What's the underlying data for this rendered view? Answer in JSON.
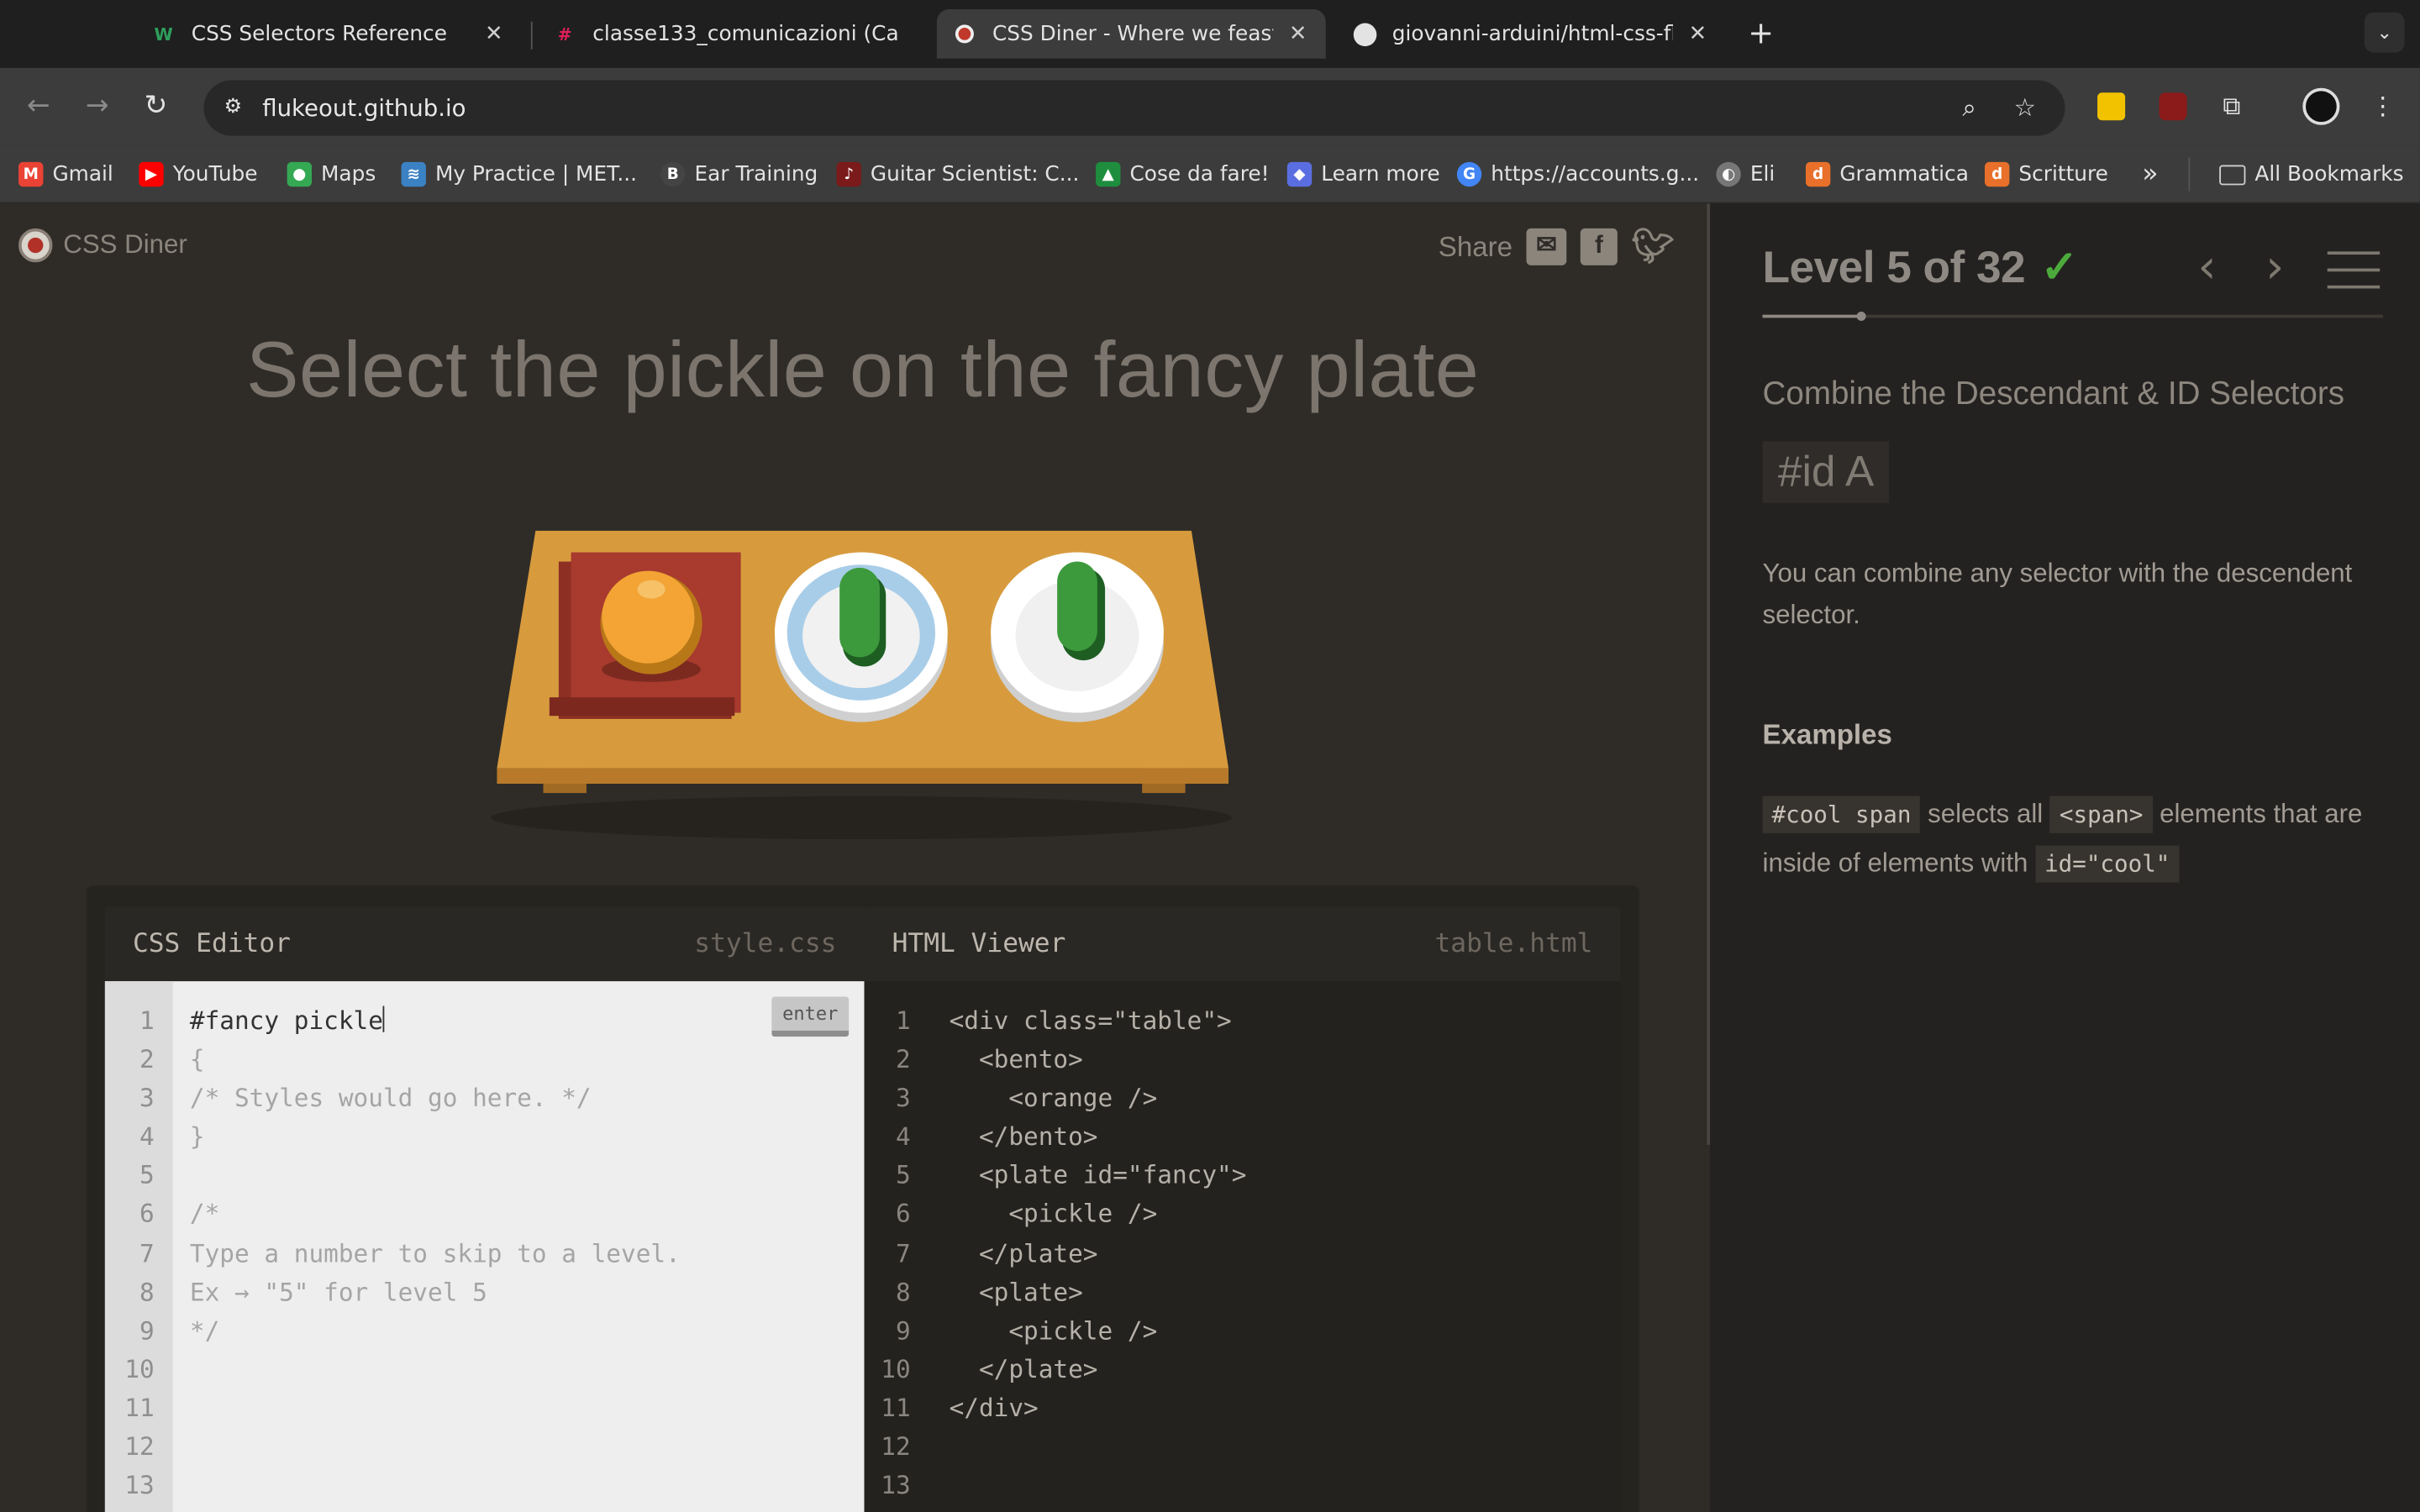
{
  "browser": {
    "tabs": [
      {
        "title": "CSS Selectors Reference",
        "favicon": "w3-icon",
        "active": false
      },
      {
        "title": "classe133_comunicazioni (Ca",
        "favicon": "slack-icon",
        "active": false
      },
      {
        "title": "CSS Diner - Where we feast o",
        "favicon": "css-diner-icon",
        "active": true
      },
      {
        "title": "giovanni-arduini/html-css-flu",
        "favicon": "github-icon",
        "active": false
      }
    ],
    "url": "flukeout.github.io",
    "bookmarks": [
      {
        "label": "Gmail",
        "color": "#ea4335",
        "glyph": "M"
      },
      {
        "label": "YouTube",
        "color": "#ff0000",
        "glyph": "▶"
      },
      {
        "label": "Maps",
        "color": "#34a853",
        "glyph": "●"
      },
      {
        "label": "My Practice | MET...",
        "color": "#3b82c4",
        "glyph": "≋"
      },
      {
        "label": "Ear Training",
        "color": "#444444",
        "glyph": "B"
      },
      {
        "label": "Guitar Scientist: C...",
        "color": "#7a1a1a",
        "glyph": "♪"
      },
      {
        "label": "Cose da fare!",
        "color": "#1e8e3e",
        "glyph": "▲"
      },
      {
        "label": "Learn more",
        "color": "#5b6ee1",
        "glyph": "◆"
      },
      {
        "label": "https://accounts.g...",
        "color": "#4285f4",
        "glyph": "G"
      },
      {
        "label": "Eli",
        "color": "#777777",
        "glyph": "◐"
      },
      {
        "label": "Grammatica",
        "color": "#e8702a",
        "glyph": "d"
      },
      {
        "label": "Scritture",
        "color": "#e8702a",
        "glyph": "d"
      }
    ],
    "overflow": "»",
    "all_bookmarks": "All Bookmarks"
  },
  "game": {
    "logo": "CSS Diner",
    "share": "Share",
    "headline": "Select the pickle on the fancy plate",
    "css_editor": {
      "title": "CSS Editor",
      "file": "style.css",
      "enter": "enter",
      "typed": "#fancy pickle",
      "lines": [
        "{",
        "/* Styles would go here. */",
        "}",
        "",
        "/*",
        "Type a number to skip to a level.",
        "Ex → \"5\" for level 5",
        "*/",
        "",
        "",
        "",
        ""
      ]
    },
    "html_viewer": {
      "title": "HTML Viewer",
      "file": "table.html",
      "lines": [
        "<div class=\"table\">",
        "  <bento>",
        "    <orange />",
        "  </bento>",
        "  <plate id=\"fancy\">",
        "    <pickle />",
        "  </plate>",
        "  <plate>",
        "    <pickle />",
        "  </plate>",
        "</div>",
        "",
        ""
      ]
    },
    "line_numbers": [
      "1",
      "2",
      "3",
      "4",
      "5",
      "6",
      "7",
      "8",
      "9",
      "10",
      "11",
      "12",
      "13"
    ]
  },
  "sidebar": {
    "level": "Level 5 of 32",
    "check": "✓",
    "progress": 0.16,
    "selector_name": "Combine the Descendant & ID Selectors",
    "syntax": "#id  A",
    "hint": "You can combine any selector with the descendent selector.",
    "examples_title": "Examples",
    "example": {
      "code1": "#cool span",
      "text1": " selects all ",
      "code2": "<span>",
      "text2": " elements that are inside of elements with ",
      "code3": "id=\"cool\""
    }
  }
}
